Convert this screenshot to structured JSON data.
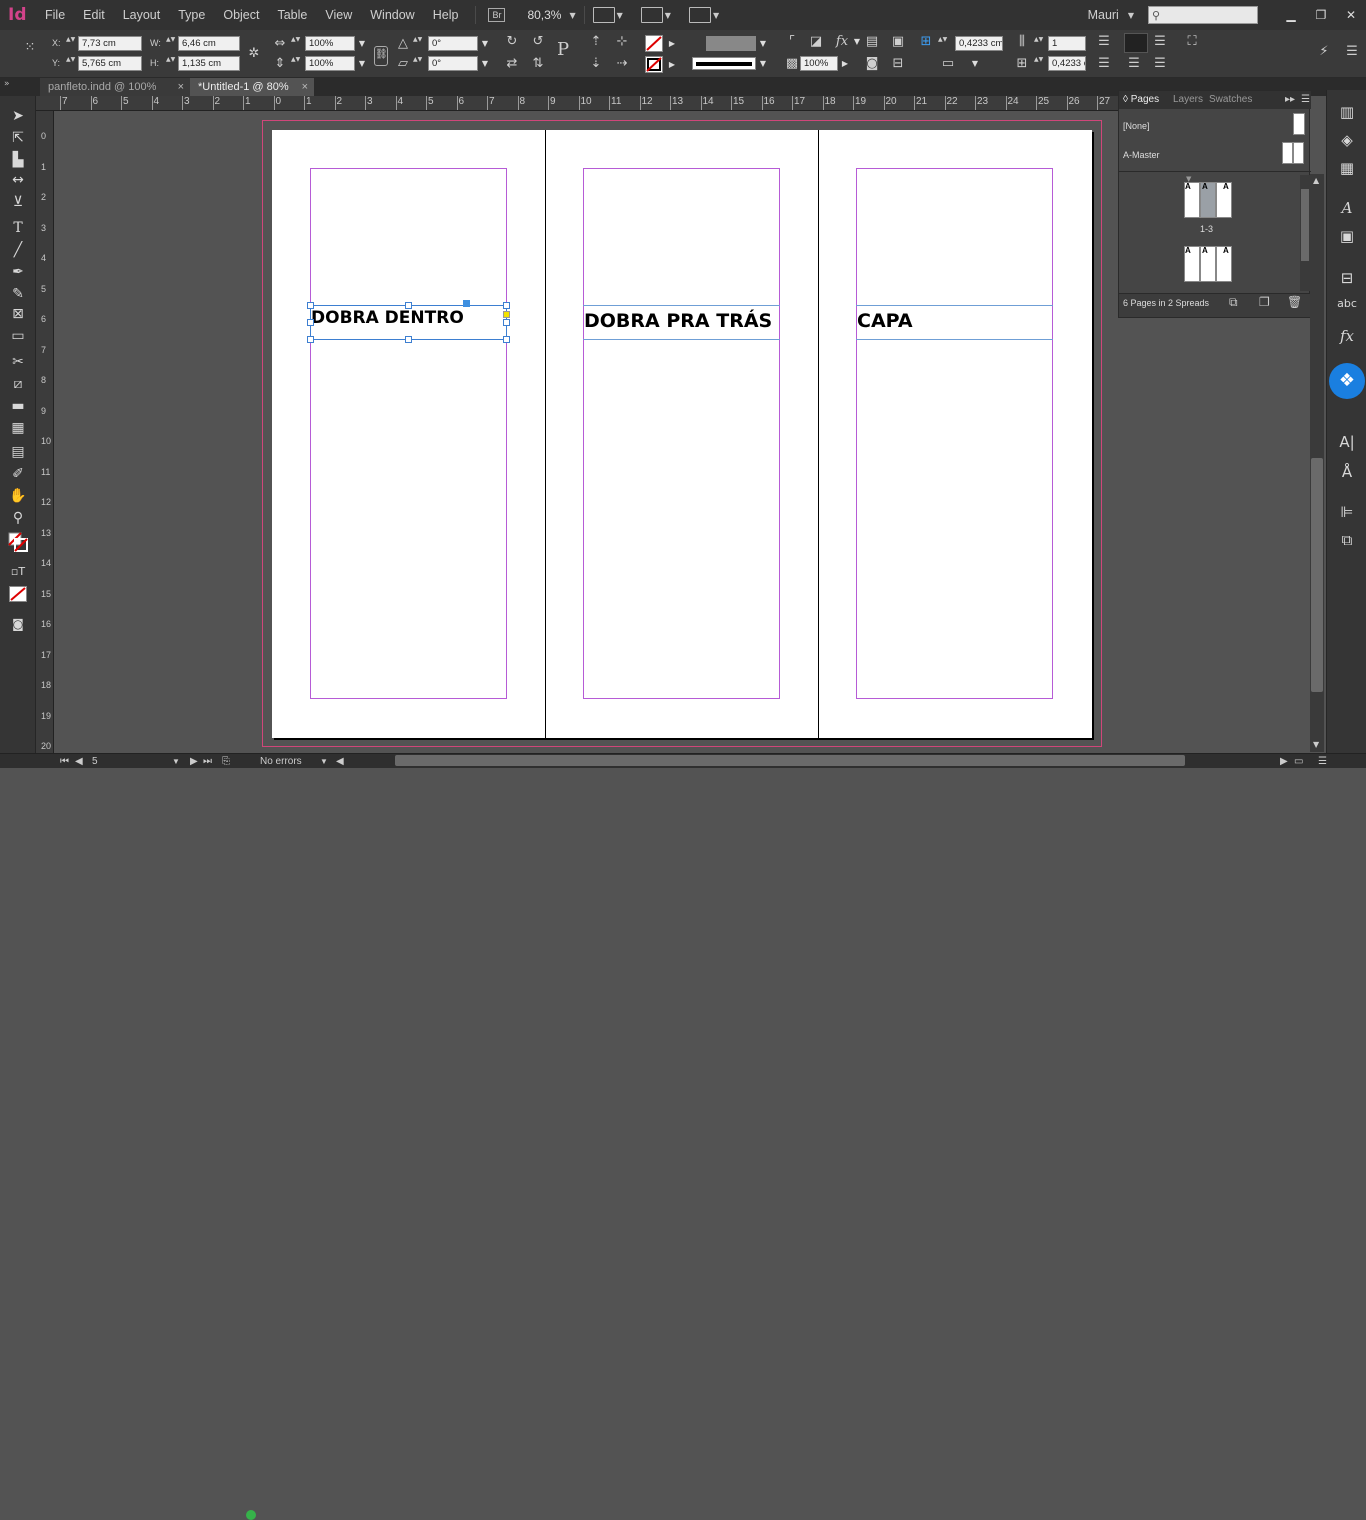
{
  "app": {
    "logo": "Id"
  },
  "menu": [
    "File",
    "Edit",
    "Layout",
    "Type",
    "Object",
    "Table",
    "View",
    "Window",
    "Help"
  ],
  "bridge": "Br",
  "zoom": "80,3%",
  "user": "Mauri",
  "search": {
    "placeholder": ""
  },
  "control": {
    "x_label": "X:",
    "x_value": "7,73 cm",
    "y_label": "Y:",
    "y_value": "5,765 cm",
    "w_label": "W:",
    "w_value": "6,46 cm",
    "h_label": "H:",
    "h_value": "1,135 cm",
    "scale_x": "100%",
    "scale_y": "100%",
    "rotate": "0°",
    "shear": "0°",
    "stroke_weight": "0,4233 cm",
    "stroke_weight2": "0,4233 c",
    "columns": "1",
    "opacity": "100%"
  },
  "tabs": [
    {
      "label": "panfleto.indd @ 100%",
      "close": "×"
    },
    {
      "label": "*Untitled-1 @ 80%",
      "close": "×"
    }
  ],
  "ruler_top": [
    "7",
    "6",
    "5",
    "4",
    "3",
    "2",
    "1",
    "0",
    "1",
    "2",
    "3",
    "4",
    "5",
    "6",
    "7",
    "8",
    "9",
    "10",
    "11",
    "12",
    "13",
    "14",
    "15",
    "16",
    "17",
    "18",
    "19",
    "20",
    "21",
    "22",
    "23",
    "24",
    "25",
    "26",
    "27"
  ],
  "ruler_left": [
    "0",
    "1",
    "2",
    "3",
    "4",
    "5",
    "6",
    "7",
    "8",
    "9",
    "10",
    "11",
    "12",
    "13",
    "14",
    "15",
    "16",
    "17",
    "18",
    "19",
    "20"
  ],
  "document": {
    "panel1_text": "DOBRA DENTRO",
    "panel2_text": "DOBRA PRA TRÁS",
    "panel3_text": "CAPA"
  },
  "pages_panel": {
    "tabs": [
      "Pages",
      "Layers",
      "Swatches"
    ],
    "none_label": "[None]",
    "master_label": "A-Master",
    "spread1_label": "1-3",
    "spread_letter": "A",
    "footer": "6 Pages in 2 Spreads"
  },
  "status": {
    "page": "5",
    "errors": "No errors"
  },
  "colors": {
    "accent_logo": "#d2438a",
    "bleed": "#d0467a",
    "margin": "#b65bd6",
    "frame": "#6f9fd6",
    "status_ok": "#36b24a",
    "dropbox": "#1a7fe0"
  }
}
